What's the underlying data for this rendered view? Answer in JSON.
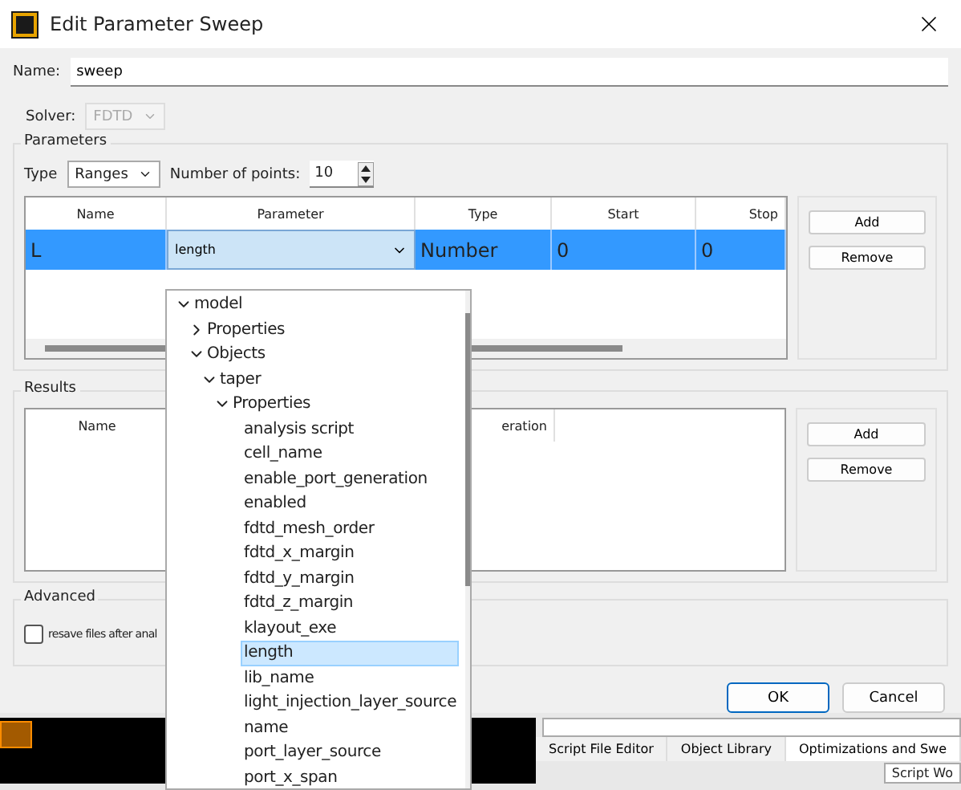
{
  "window": {
    "title": "Edit Parameter Sweep"
  },
  "name_field": {
    "label": "Name:",
    "value": "sweep"
  },
  "solver": {
    "label": "Solver:",
    "value": "FDTD",
    "disabled": true
  },
  "parameters": {
    "title": "Parameters",
    "type_label": "Type",
    "type_value": "Ranges",
    "points_label": "Number of points:",
    "points_value": "10",
    "columns": [
      "Name",
      "Parameter",
      "Type",
      "Start",
      "Stop"
    ],
    "rows": [
      {
        "name": "L",
        "parameter": "length",
        "type": "Number",
        "start": "0",
        "stop": "0",
        "selected": true
      }
    ],
    "buttons": [
      "Add",
      "Remove"
    ]
  },
  "results": {
    "title": "Results",
    "columns": [
      "Name",
      "eration"
    ],
    "buttons": [
      "Add",
      "Remove"
    ]
  },
  "advanced": {
    "title": "Advanced",
    "checkbox": {
      "label": "resave files after anal",
      "checked": false
    }
  },
  "dialog_buttons": [
    {
      "label": "OK",
      "default": true
    },
    {
      "label": "Cancel",
      "default": false
    }
  ],
  "background_tabs": [
    {
      "label": "Script File Editor",
      "selected": false
    },
    {
      "label": "Object Library",
      "selected": false
    },
    {
      "label": "Optimizations and Swe",
      "selected": true
    }
  ],
  "background_panel_tab": "Script Wo",
  "parameter_dropdown": {
    "tree": [
      {
        "label": "model",
        "expanded": true,
        "selected": false,
        "children": [
          {
            "label": "Properties",
            "expanded": false,
            "selected": false
          },
          {
            "label": "Objects",
            "expanded": true,
            "selected": false,
            "children": [
              {
                "label": "taper",
                "expanded": true,
                "selected": false,
                "children": [
                  {
                    "label": "Properties",
                    "expanded": true,
                    "selected": false,
                    "children": [
                      {
                        "label": "analysis script",
                        "selected": false
                      },
                      {
                        "label": "cell_name",
                        "selected": false
                      },
                      {
                        "label": "enable_port_generation",
                        "selected": false
                      },
                      {
                        "label": "enabled",
                        "selected": false
                      },
                      {
                        "label": "fdtd_mesh_order",
                        "selected": false
                      },
                      {
                        "label": "fdtd_x_margin",
                        "selected": false
                      },
                      {
                        "label": "fdtd_y_margin",
                        "selected": false
                      },
                      {
                        "label": "fdtd_z_margin",
                        "selected": false
                      },
                      {
                        "label": "klayout_exe",
                        "selected": false
                      },
                      {
                        "label": "length",
                        "selected": true
                      },
                      {
                        "label": "lib_name",
                        "selected": false
                      },
                      {
                        "label": "light_injection_layer_source",
                        "selected": false
                      },
                      {
                        "label": "name",
                        "selected": false
                      },
                      {
                        "label": "port_layer_source",
                        "selected": false
                      },
                      {
                        "label": "port_x_span",
                        "selected": false
                      }
                    ]
                  }
                ]
              }
            ]
          }
        ]
      }
    ]
  }
}
